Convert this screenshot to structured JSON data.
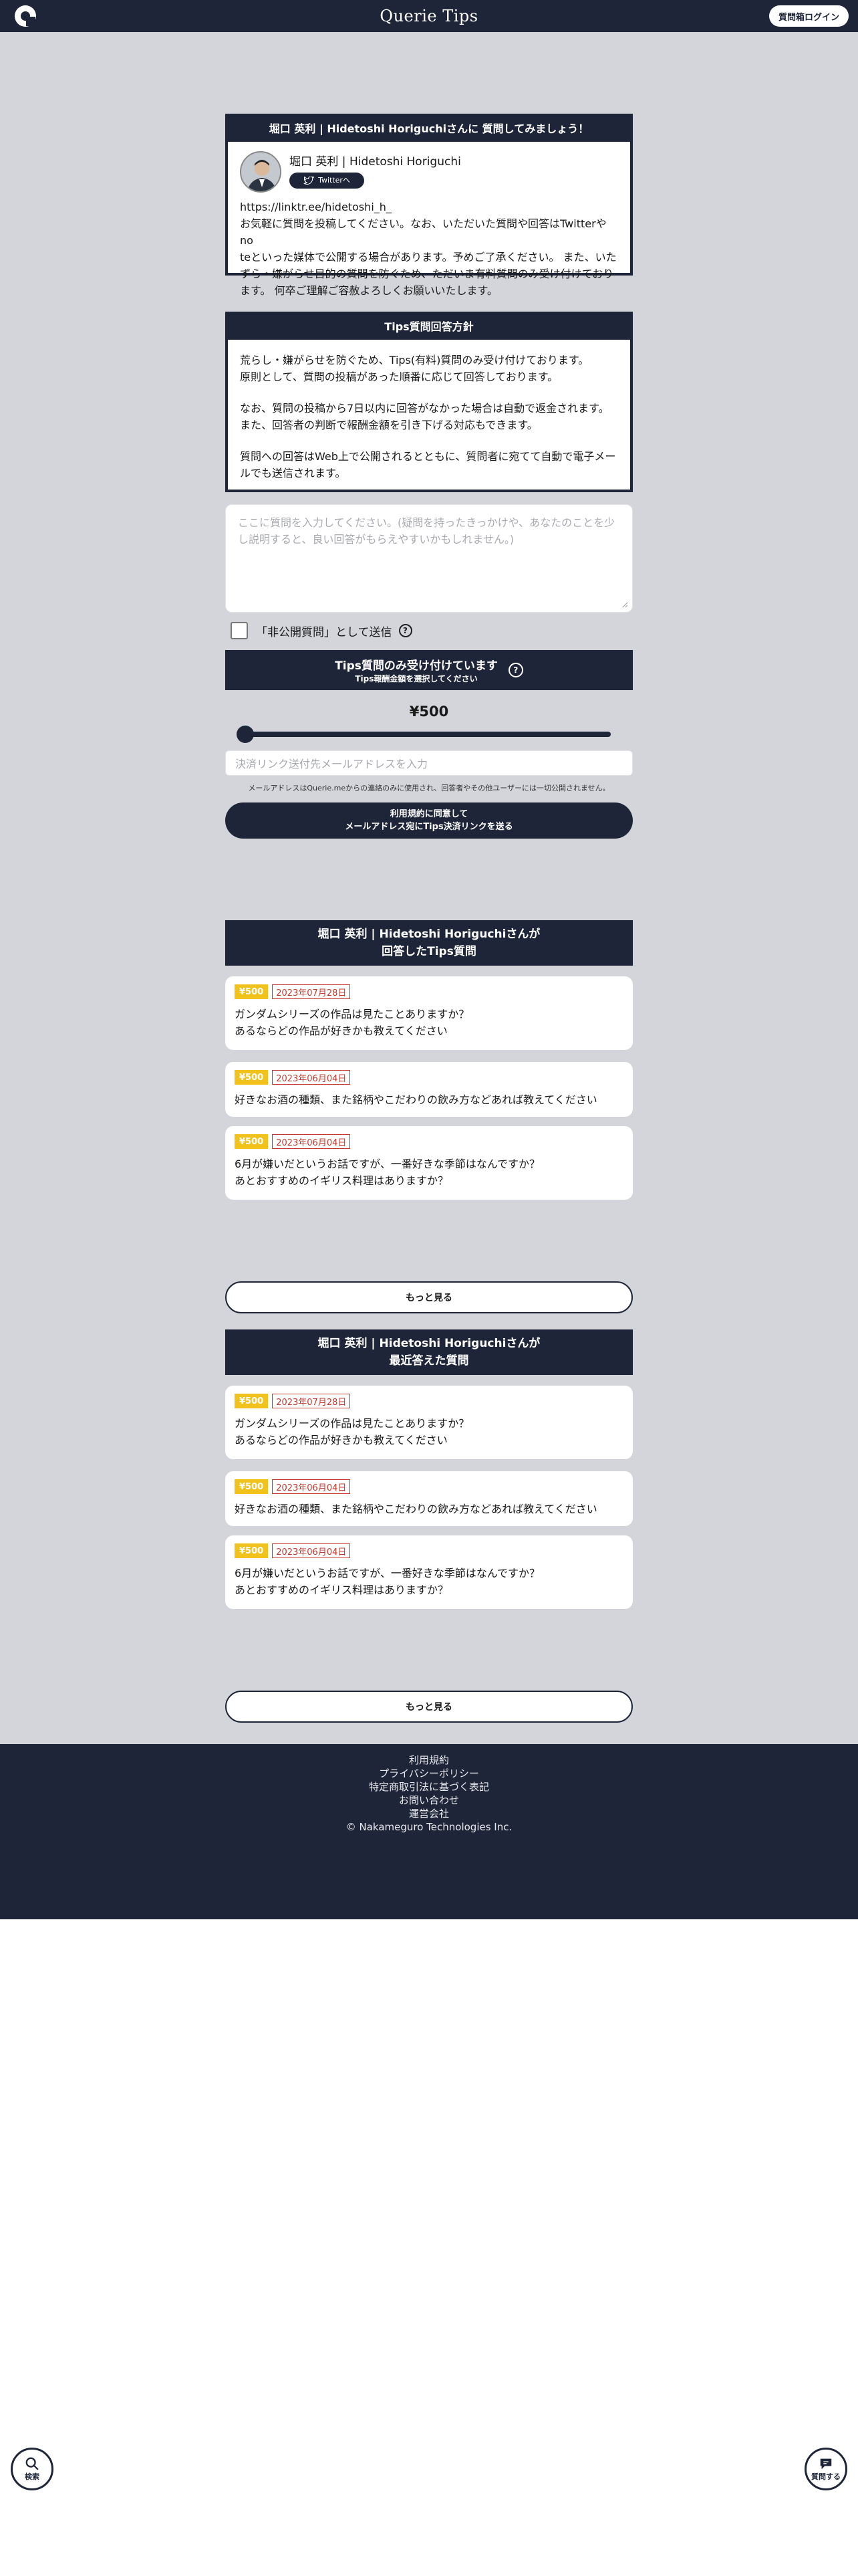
{
  "header": {
    "site_title": "Querie Tips",
    "login_label": "質問箱ログイン"
  },
  "profile_card": {
    "heading": "堀口 英利 | Hidetoshi Horiguchiさんに 質問してみましょう！",
    "name": "堀口 英利 | Hidetoshi Horiguchi",
    "twitter_label": "Twitterへ",
    "link": "https://linktr.ee/hidetoshi_h_",
    "intro_lines": [
      "お気軽に質問を投稿してください。なお、いただいた質問や回答はTwitterやno",
      "teといった媒体で公開する場合があります。予めご了承ください。 また、いた",
      "ずら・嫌がらせ目的の質問を防ぐため、ただいま有料質問のみ受け付けており",
      "ます。 何卒ご理解ご容赦よろしくお願いいたします。"
    ]
  },
  "policy_card": {
    "heading": "Tips質問回答方針",
    "paragraphs": [
      [
        "荒らし・嫌がらせを防ぐため、Tips(有料)質問のみ受け付けております。",
        "原則として、質問の投稿があった順番に応じて回答しております。"
      ],
      [
        "なお、質問の投稿から7日以内に回答がなかった場合は自動で返金されます。",
        "また、回答者の判断で報酬金額を引き下げる対応もできます。"
      ],
      [
        "質問への回答はWeb上で公開されるとともに、質問者に宛てて自動で電子メー",
        "ルでも送信されます。"
      ]
    ]
  },
  "question_form": {
    "placeholder_lines": [
      "ここに質問を入力してください。(疑問を持ったきっかけや、あなたのことを少",
      "し説明すると、良い回答がもらえやすいかもしれません。)"
    ],
    "private_label": "「非公開質問」として送信",
    "private_checked": false,
    "help_glyph": "?",
    "tips_title": "Tips質問のみ受け付けています",
    "tips_subtitle": "Tips報酬金額を選択してください",
    "price": "¥500",
    "slider_fraction": 0.0,
    "email_placeholder": "決済リンク送付先メールアドレスを入力",
    "email_notice": "メールアドレスはQuerie.meからの連絡のみに使用され、回答者やその他ユーザーには一切公開されません。",
    "send_line1": "利用規約に同意して",
    "send_line2": "メールアドレス宛にTips決済リンクを送る"
  },
  "answered_section": {
    "heading_line1": "堀口 英利 | Hidetoshi Horiguchiさんが",
    "heading_line2": "回答したTips質問",
    "items": [
      {
        "price": "¥500",
        "date": "2023年07月28日",
        "lines": [
          "ガンダムシリーズの作品は見たことありますか？",
          "あるならどの作品が好きかも教えてください"
        ]
      },
      {
        "price": "¥500",
        "date": "2023年06月04日",
        "lines": [
          "好きなお酒の種類、また銘柄やこだわりの飲み方などあれば教えてください"
        ]
      },
      {
        "price": "¥500",
        "date": "2023年06月04日",
        "lines": [
          "6月が嫌いだというお話ですが、一番好きな季節はなんですか？",
          "あとおすすめのイギリス料理はありますか？"
        ]
      }
    ],
    "more_label": "もっと見る"
  },
  "recent_section": {
    "heading_line1": "堀口 英利 | Hidetoshi Horiguchiさんが",
    "heading_line2": "最近答えた質問",
    "items": [
      {
        "price": "¥500",
        "date": "2023年07月28日",
        "lines": [
          "ガンダムシリーズの作品は見たことありますか？",
          "あるならどの作品が好きかも教えてください"
        ]
      },
      {
        "price": "¥500",
        "date": "2023年06月04日",
        "lines": [
          "好きなお酒の種類、また銘柄やこだわりの飲み方などあれば教えてください"
        ]
      },
      {
        "price": "¥500",
        "date": "2023年06月04日",
        "lines": [
          "6月が嫌いだというお話ですが、一番好きな季節はなんですか？",
          "あとおすすめのイギリス料理はありますか？"
        ]
      }
    ],
    "more_label": "もっと見る"
  },
  "footer": {
    "links": [
      "利用規約",
      "プライバシーポリシー",
      "特定商取引法に基づく表記",
      "お問い合わせ",
      "運営会社"
    ],
    "copyright": "© Nakameguro Technologies Inc."
  },
  "fabs": {
    "search_label": "検索",
    "ask_label": "質問する"
  },
  "colors": {
    "navy": "#1e2538",
    "page_grey": "#d3d5da",
    "price_tag": "#f2c21c",
    "date_tag": "#c0392b"
  }
}
